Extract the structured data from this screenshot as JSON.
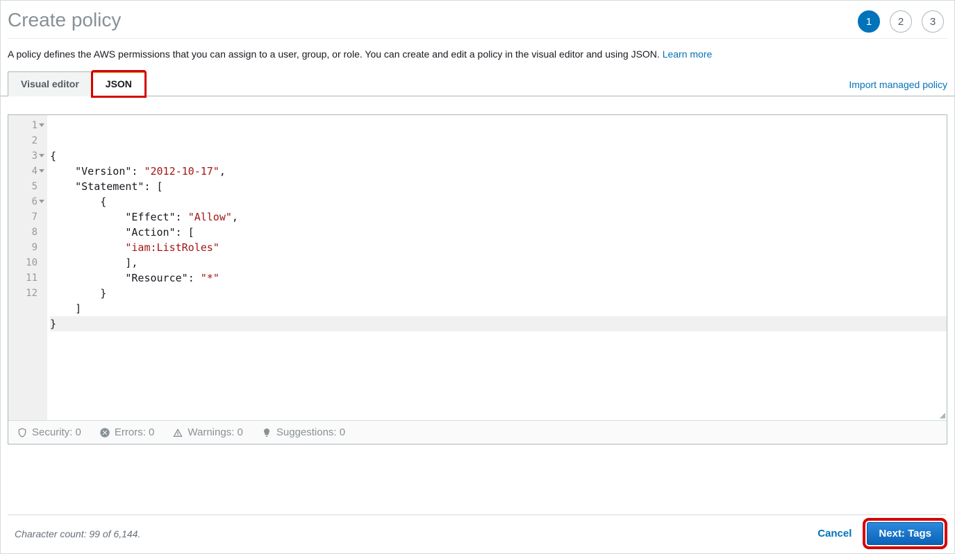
{
  "header": {
    "title": "Create policy",
    "steps": [
      {
        "label": "1",
        "active": true
      },
      {
        "label": "2",
        "active": false
      },
      {
        "label": "3",
        "active": false
      }
    ]
  },
  "description": {
    "text": "A policy defines the AWS permissions that you can assign to a user, group, or role. You can create and edit a policy in the visual editor and using JSON. ",
    "learn_more": "Learn more"
  },
  "tabs": {
    "visual_editor": "Visual editor",
    "json": "JSON"
  },
  "import_link": "Import managed policy",
  "editor": {
    "lines": [
      {
        "n": "1",
        "fold": true,
        "segments": [
          {
            "t": "{",
            "c": ""
          }
        ]
      },
      {
        "n": "2",
        "segments": [
          {
            "t": "    ",
            "c": ""
          },
          {
            "t": "\"Version\"",
            "c": "tok-key"
          },
          {
            "t": ": ",
            "c": ""
          },
          {
            "t": "\"2012-10-17\"",
            "c": "tok-str"
          },
          {
            "t": ",",
            "c": ""
          }
        ]
      },
      {
        "n": "3",
        "fold": true,
        "segments": [
          {
            "t": "    ",
            "c": ""
          },
          {
            "t": "\"Statement\"",
            "c": "tok-key"
          },
          {
            "t": ": [",
            "c": ""
          }
        ]
      },
      {
        "n": "4",
        "fold": true,
        "segments": [
          {
            "t": "        {",
            "c": ""
          }
        ]
      },
      {
        "n": "5",
        "segments": [
          {
            "t": "            ",
            "c": ""
          },
          {
            "t": "\"Effect\"",
            "c": "tok-key"
          },
          {
            "t": ": ",
            "c": ""
          },
          {
            "t": "\"Allow\"",
            "c": "tok-str"
          },
          {
            "t": ",",
            "c": ""
          }
        ]
      },
      {
        "n": "6",
        "fold": true,
        "segments": [
          {
            "t": "            ",
            "c": ""
          },
          {
            "t": "\"Action\"",
            "c": "tok-key"
          },
          {
            "t": ": [",
            "c": ""
          }
        ]
      },
      {
        "n": "7",
        "segments": [
          {
            "t": "            ",
            "c": ""
          },
          {
            "t": "\"iam:ListRoles\"",
            "c": "tok-str"
          }
        ]
      },
      {
        "n": "8",
        "segments": [
          {
            "t": "            ],",
            "c": ""
          }
        ]
      },
      {
        "n": "9",
        "segments": [
          {
            "t": "            ",
            "c": ""
          },
          {
            "t": "\"Resource\"",
            "c": "tok-key"
          },
          {
            "t": ": ",
            "c": ""
          },
          {
            "t": "\"*\"",
            "c": "tok-str"
          }
        ]
      },
      {
        "n": "10",
        "segments": [
          {
            "t": "        }",
            "c": ""
          }
        ]
      },
      {
        "n": "11",
        "segments": [
          {
            "t": "    ]",
            "c": ""
          }
        ]
      },
      {
        "n": "12",
        "active": true,
        "segments": [
          {
            "t": "}",
            "c": ""
          }
        ]
      }
    ]
  },
  "status": {
    "security": "Security: 0",
    "errors": "Errors: 0",
    "warnings": "Warnings: 0",
    "suggestions": "Suggestions: 0"
  },
  "footer": {
    "char_count": "Character count: 99 of 6,144.",
    "cancel": "Cancel",
    "next": "Next: Tags"
  }
}
